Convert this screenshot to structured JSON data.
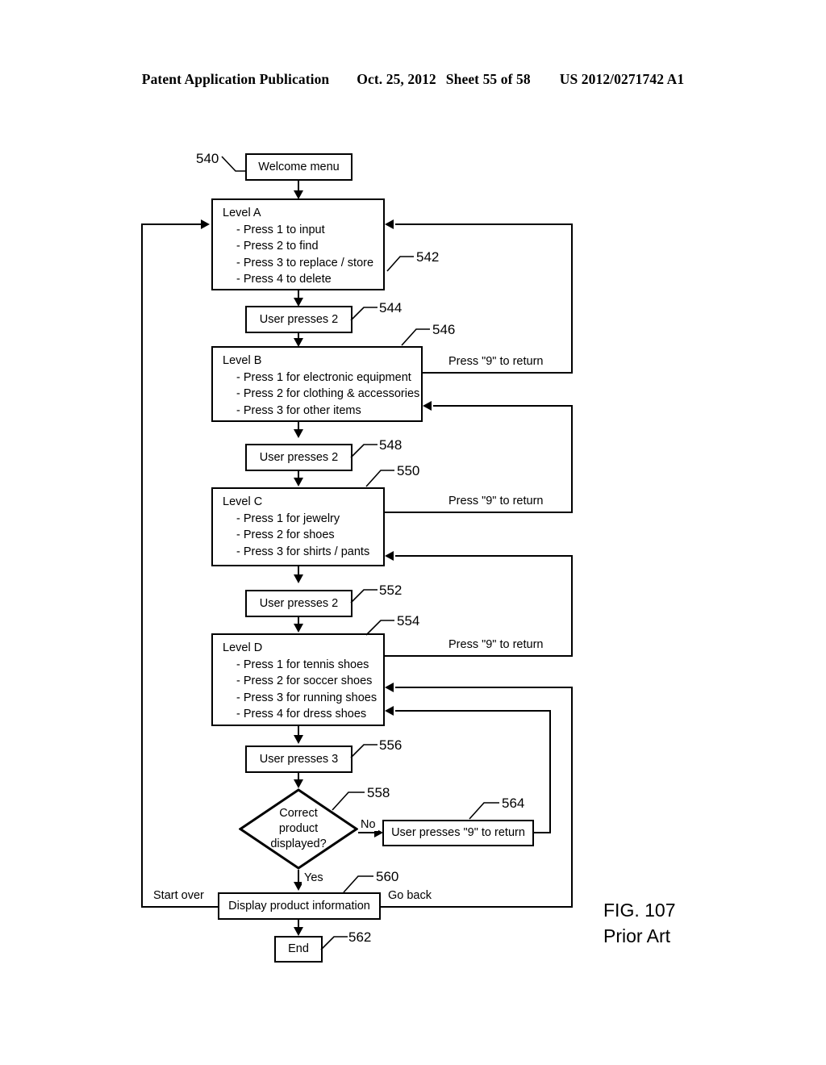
{
  "header": {
    "publication": "Patent Application Publication",
    "date": "Oct. 25, 2012",
    "sheet": "Sheet 55 of 58",
    "docnum": "US 2012/0271742 A1"
  },
  "figure": {
    "number": "FIG. 107",
    "note": "Prior Art"
  },
  "nodes": {
    "welcome": {
      "ref": "540",
      "label": "Welcome menu"
    },
    "level_a": {
      "ref": "542",
      "title": "Level A",
      "options": [
        "- Press 1 to input",
        "- Press 2 to find",
        "- Press 3 to replace / store",
        "- Press 4 to delete"
      ]
    },
    "press_a": {
      "ref": "544",
      "label": "User presses 2"
    },
    "level_b": {
      "ref": "546",
      "title": "Level B",
      "options": [
        "- Press 1 for electronic equipment",
        "- Press 2 for clothing & accessories",
        "- Press 3 for other items"
      ]
    },
    "press_b": {
      "ref": "548",
      "label": "User presses 2"
    },
    "level_c": {
      "ref": "550",
      "title": "Level C",
      "options": [
        "- Press 1 for jewelry",
        "- Press 2 for shoes",
        "- Press 3 for shirts / pants"
      ]
    },
    "press_c": {
      "ref": "552",
      "label": "User presses 2"
    },
    "level_d": {
      "ref": "554",
      "title": "Level D",
      "options": [
        "- Press 1 for tennis shoes",
        "- Press 2 for soccer shoes",
        "- Press 3 for running shoes",
        "- Press 4 for dress shoes"
      ]
    },
    "press_d": {
      "ref": "556",
      "label": "User presses 3"
    },
    "decision": {
      "ref": "558",
      "line1": "Correct",
      "line2": "product",
      "line3": "displayed?"
    },
    "return_box": {
      "ref": "564",
      "label": "User presses \"9\" to return"
    },
    "display": {
      "ref": "560",
      "label": "Display product information"
    },
    "end": {
      "ref": "562",
      "label": "End"
    }
  },
  "edges": {
    "return_b": "Press \"9\" to return",
    "return_c": "Press \"9\" to return",
    "return_d": "Press \"9\" to return",
    "no": "No",
    "yes": "Yes",
    "start_over": "Start over",
    "go_back": "Go back"
  },
  "colors": {
    "ink": "#000000",
    "paper": "#ffffff"
  }
}
